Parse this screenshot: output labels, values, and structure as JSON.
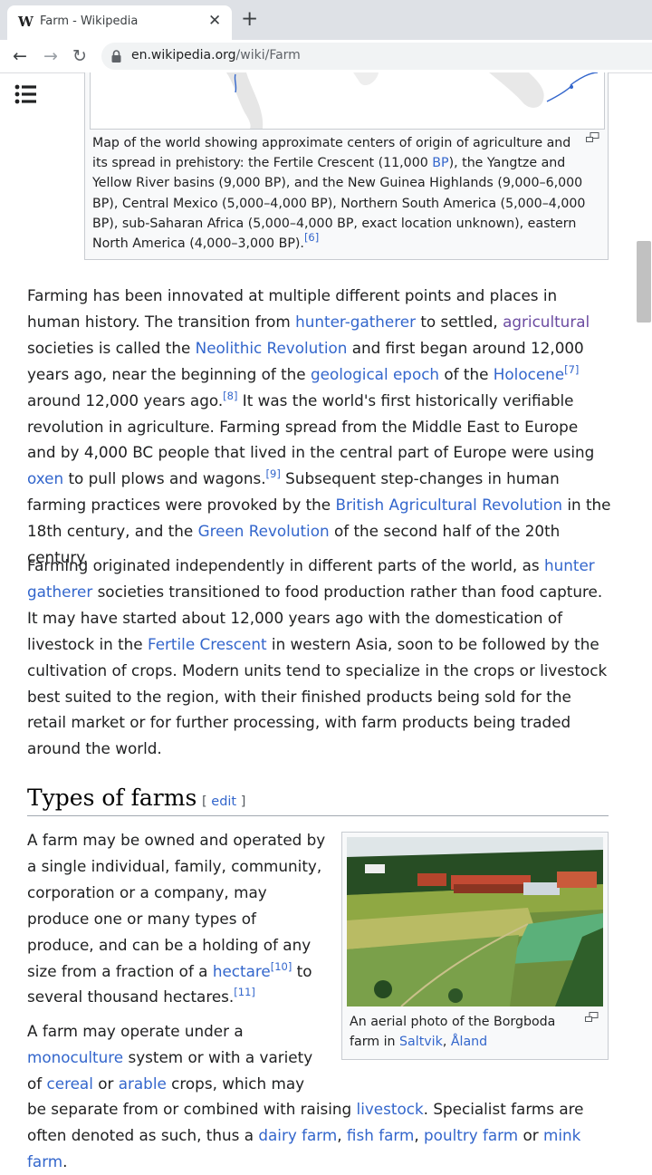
{
  "browser": {
    "tab": {
      "favicon": "W",
      "title": "Farm - Wikipedia",
      "close": "✕"
    },
    "new_tab": "+",
    "nav": {
      "back": "←",
      "forward": "→",
      "reload": "↻"
    },
    "url": {
      "domain": "en.wikipedia.org",
      "path": "/wiki/Farm"
    }
  },
  "icons": {
    "toc": "toc-list-icon",
    "lock": "lock-icon",
    "magnify": "enlarge-icon",
    "map": "world-map-image",
    "photo": "aerial-farm-photo"
  },
  "colors": {
    "link": "#3366cc",
    "visited": "#6b4ba1",
    "text": "#202122",
    "border": "#c8ccd1"
  },
  "figure1": {
    "caption_text": "Map of the world showing approximate centers of origin of agriculture and its spread in prehistory: the Fertile Crescent (11,000 ",
    "caption_link": "BP",
    "caption_rest": "), the Yangtze and Yellow River basins (9,000 BP), and the New Guinea Highlands (9,000–6,000 BP), Central Mexico (5,000–4,000 BP), Northern South America (5,000–4,000 BP), sub-Saharan Africa (5,000–4,000 BP, exact location unknown), eastern North America (4,000–3,000 BP).",
    "ref": "[6]"
  },
  "p1": {
    "t1": "Farming has been innovated at multiple different points and places in human history. The transition from ",
    "l1": "hunter-gatherer",
    "t2": " to settled, ",
    "l2": "agricultural",
    "t3": " societies is called the ",
    "l3": "Neolithic Revolution",
    "t4": " and first began around 12,000 years ago, near the beginning of the ",
    "l4": "geological epoch",
    "t5": " of the ",
    "l5": "Holocene",
    "r1": "[7]",
    "t6": " around 12,000 years ago.",
    "r2": "[8]",
    "t7": " It was the world's first historically verifiable revolution in agriculture. Farming spread from the Middle East to Europe and by 4,000 BC people that lived in the central part of Europe were using ",
    "l6": "oxen",
    "t8": " to pull plows and wagons.",
    "r3": "[9]",
    "t9": " Subsequent step-changes in human farming practices were provoked by the ",
    "l7": "British Agricultural Revolution",
    "t10": " in the 18th century, and the ",
    "l8": "Green Revolution",
    "t11": " of the second half of the 20th century."
  },
  "p2": {
    "t1": "Farming originated independently in different parts of the world, as ",
    "l1": "hunter gatherer",
    "t2": " societies transitioned to food production rather than food capture. It may have started about 12,000 years ago with the domestication of livestock in the ",
    "l2": "Fertile Crescent",
    "t3": " in western Asia, soon to be followed by the cultivation of crops. Modern units tend to specialize in the crops or livestock best suited to the region, with their finished products being sold for the retail market or for further processing, with farm products being traded around the world."
  },
  "section": {
    "title": "Types of farms",
    "edit_open": "[ ",
    "edit": "edit",
    "edit_close": " ]"
  },
  "figure2": {
    "caption_text": "An aerial photo of the Borgboda farm in ",
    "link1": "Saltvik",
    "sep": ", ",
    "link2": "Åland"
  },
  "p3": {
    "t1": "A farm may be owned and operated by a single individual, family, community, corporation or a company, may produce one or many types of produce, and can be a holding of any size from a fraction of a ",
    "l1": "hectare",
    "r1": "[10]",
    "t2": " to several thousand hectares.",
    "r2": "[11]"
  },
  "p4": {
    "t1": "A farm may operate under a ",
    "l1": "monoculture",
    "t2": " system or with a variety of ",
    "l2": "cereal",
    "t3": " or ",
    "l3": "arable",
    "t4": " crops, which may"
  },
  "p5": {
    "t1": "be separate from or combined with raising ",
    "l1": "livestock",
    "t2": ". Specialist farms are often denoted as such, thus a ",
    "l2": "dairy farm",
    "s1": ", ",
    "l3": "fish farm",
    "s2": ", ",
    "l4": "poultry farm",
    "t3": " or ",
    "l5": "mink farm",
    "t4": "."
  }
}
